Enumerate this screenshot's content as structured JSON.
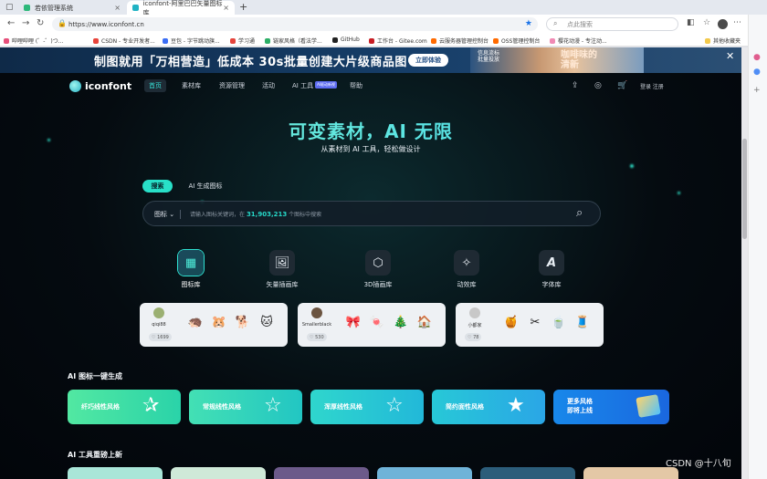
{
  "browser": {
    "tabs": [
      {
        "title": "若依管理系统",
        "active": false
      },
      {
        "title": "iconfont-阿里巴巴矢量图标库",
        "active": true
      }
    ],
    "new_tab": "+",
    "address": "https://www.iconfont.cn",
    "search_placeholder": "点此搜索",
    "bookmarks": [
      "哔哩哔哩 (゜-゜)つ...",
      "CSDN - 专业开发者...",
      "豆包 - 字节跳动旗...",
      "学习通",
      "链家风格（看法学...",
      "GitHub",
      "工作台 - Gitee.com",
      "云服务器管理控制台",
      "OSS管理控制台",
      "樱花动漫 - 专注动...",
      "其他收藏夹"
    ]
  },
  "banner": {
    "text": "制图就用「万相营造」低成本 30s批量创建大片级商品图",
    "button": "立即体验",
    "art_text_left": "信息流标\n批量投放",
    "art_text_right": "咖啡味的\n清新"
  },
  "nav": {
    "logo": "iconfont",
    "items": [
      "首页",
      "素材库",
      "资源管理",
      "活动",
      "AI 工具",
      "帮助"
    ],
    "ai_badge": "AI驱动新视",
    "login": "登录 注册"
  },
  "hero": {
    "title": "可变素材，AI 无限",
    "subtitle": "从素材到 AI 工具，轻松做设计"
  },
  "search": {
    "tabs": [
      "搜索",
      "AI 生成图标"
    ],
    "category": "图标",
    "placeholder_prefix": "请输入图标关键词，在",
    "placeholder_count": "31,903,213",
    "placeholder_suffix": "个图标中搜索"
  },
  "categories": [
    {
      "label": "图标库",
      "icon": "grid-icon",
      "selected": true
    },
    {
      "label": "矢量插画库",
      "icon": "image-icon",
      "selected": false
    },
    {
      "label": "3D插画库",
      "icon": "cube-icon",
      "selected": false
    },
    {
      "label": "动效库",
      "icon": "sparkle-star-icon",
      "selected": false
    },
    {
      "label": "字体库",
      "icon": "font-icon",
      "selected": false
    }
  ],
  "showcase_cards": [
    {
      "user": "qiqi88",
      "likes": "1699",
      "icons": [
        "🦔",
        "🐹",
        "🐕",
        "🐱"
      ]
    },
    {
      "user": "Smallerblack",
      "likes": "530",
      "icons": [
        "🎀",
        "🍬",
        "🎄",
        "🏠"
      ]
    },
    {
      "user": "小都家",
      "likes": "78",
      "icons": [
        "🍯",
        "✂",
        "🍵",
        "🧵"
      ]
    }
  ],
  "ai_section": {
    "title": "AI 图标一键生成",
    "styles": [
      "纤巧线性风格",
      "常规线性风格",
      "浑厚线性风格",
      "简约面性风格",
      "更多风格\n即将上线"
    ]
  },
  "ai_tools": {
    "title": "AI 工具重磅上新"
  },
  "watermark": "CSDN @十八旬",
  "colors": {
    "accent": "#28e0c8",
    "page_bg": "#050b10",
    "banner_bg": "#163e69"
  }
}
